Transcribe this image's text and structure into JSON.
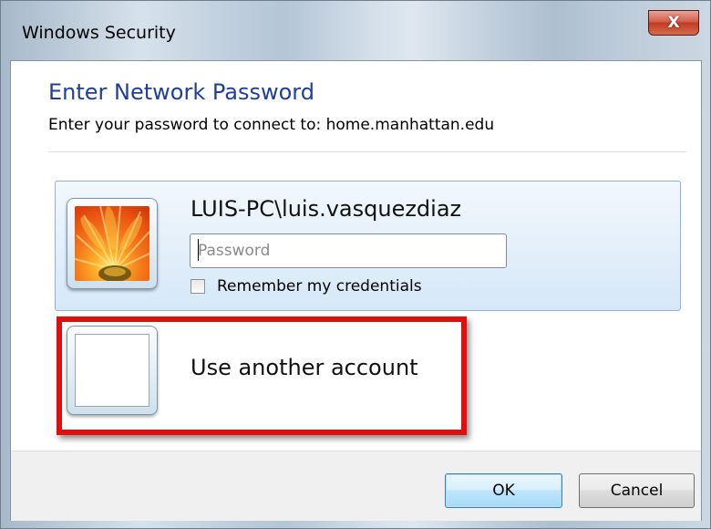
{
  "window": {
    "title": "Windows Security",
    "close_glyph": "X"
  },
  "dialog": {
    "main_instruction": "Enter Network Password",
    "connect_text": "Enter your password to connect to: home.manhattan.edu"
  },
  "credential": {
    "user_name": "LUIS-PC\\luis.vasquezdiaz",
    "password_placeholder": "Password",
    "password_value": "",
    "remember_label": "Remember my credentials",
    "remember_checked": false,
    "user_picture": "orange-flower-icon"
  },
  "other_account": {
    "label": "Use another account",
    "picture": "blank-user-tile-icon"
  },
  "buttons": {
    "ok_label": "OK",
    "cancel_label": "Cancel"
  },
  "colors": {
    "instruction_blue": "#1f3f9a",
    "highlight_red": "#e00f0f",
    "tile_background": "#e1eefa"
  }
}
